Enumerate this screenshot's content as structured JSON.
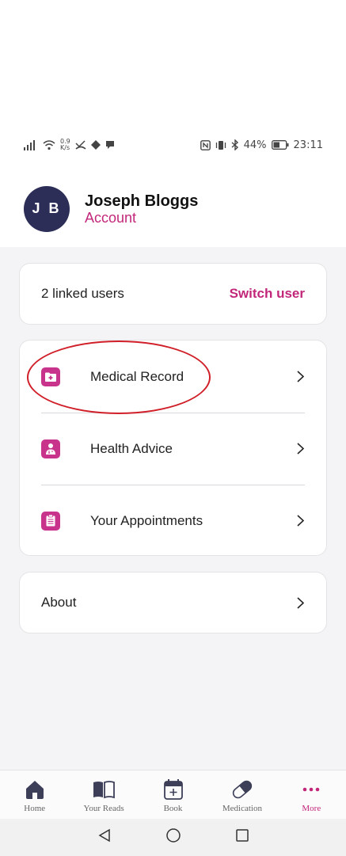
{
  "status_bar": {
    "net_speed_value": "0.9",
    "net_speed_unit": "K/s",
    "battery": "44%",
    "time": "23:11"
  },
  "account": {
    "initials": "J B",
    "name": "Joseph Bloggs",
    "link": "Account"
  },
  "linked": {
    "label": "2 linked users",
    "switch_label": "Switch user"
  },
  "menu": {
    "items": [
      {
        "label": "Medical Record",
        "icon": "medical-folder-icon"
      },
      {
        "label": "Health Advice",
        "icon": "doctor-icon"
      },
      {
        "label": "Your Appointments",
        "icon": "clipboard-icon"
      }
    ]
  },
  "about": {
    "label": "About"
  },
  "bottom_nav": {
    "items": [
      {
        "label": "Home",
        "icon": "home-icon"
      },
      {
        "label": "Your Reads",
        "icon": "book-icon"
      },
      {
        "label": "Book",
        "icon": "calendar-add-icon"
      },
      {
        "label": "Medication",
        "icon": "pill-icon"
      },
      {
        "label": "More",
        "icon": "more-dots-icon",
        "active": true
      }
    ]
  },
  "colors": {
    "accent": "#c2277a",
    "avatar_bg": "#2c2e57",
    "icon_bg": "#c8348b",
    "highlight": "#d01f28",
    "nav_icon": "#3c3f57"
  }
}
